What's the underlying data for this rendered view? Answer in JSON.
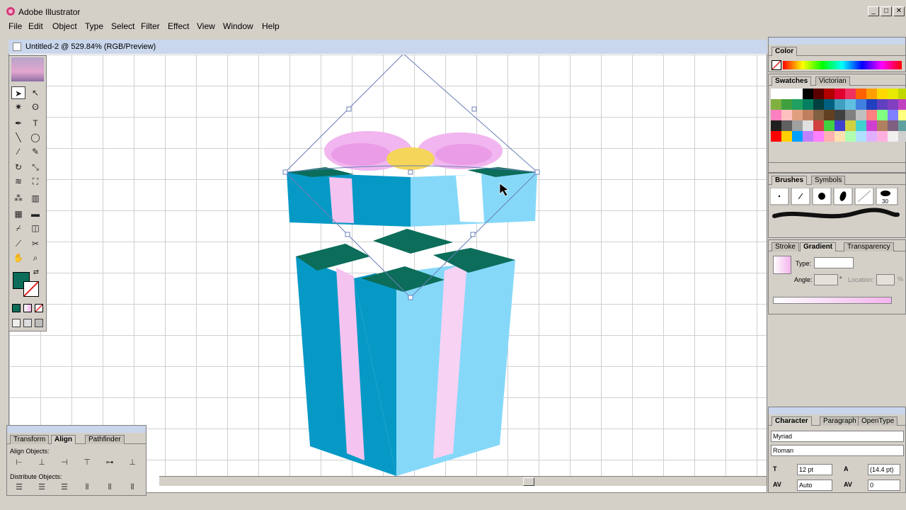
{
  "app": {
    "title": "Adobe Illustrator"
  },
  "window_buttons": {
    "minimize": "_",
    "maximize": "□",
    "close": "✕"
  },
  "menu": [
    "File",
    "Edit",
    "Object",
    "Type",
    "Select",
    "Filter",
    "Effect",
    "View",
    "Window",
    "Help"
  ],
  "document": {
    "title": "Untitled-2 @ 529.84% (RGB/Preview)"
  },
  "colors": {
    "teal": "#0b6d5a",
    "cyan_dark": "#0799c6",
    "cyan_light": "#86d8f9",
    "pink": "#f4c3ef",
    "pink_mid": "#ea9de6",
    "yellow": "#f5d55a",
    "selection": "#6a7fb8"
  },
  "color_panel": {
    "tab": "Color"
  },
  "swatches_panel": {
    "tabs": [
      "Swatches",
      "Victorian"
    ]
  },
  "brushes_panel": {
    "tabs": [
      "Brushes",
      "Symbols"
    ],
    "brush_size": "30"
  },
  "gradient_panel": {
    "tabs": [
      "Stroke",
      "Gradient",
      "Transparency"
    ],
    "type_label": "Type:",
    "angle_label": "Angle:",
    "angle_unit": "°",
    "location_label": "Location:",
    "location_unit": "%"
  },
  "character_panel": {
    "tabs": [
      "Character",
      "Paragraph",
      "OpenType"
    ],
    "font": "Myriad",
    "style": "Roman",
    "size": "12 pt",
    "leading": "(14.4 pt)",
    "kerning": "Auto",
    "tracking": "0"
  },
  "align_panel": {
    "tabs": [
      "Transform",
      "Align",
      "Pathfinder"
    ],
    "align_objects_label": "Align Objects:",
    "distribute_objects_label": "Distribute Objects:"
  },
  "icons": [
    "illustrator-app-icon",
    "selection-tool-icon",
    "direct-selection-tool-icon",
    "magic-wand-icon",
    "lasso-icon",
    "pen-icon",
    "type-icon",
    "line-icon",
    "ellipse-icon",
    "paintbrush-icon",
    "pencil-icon",
    "rotate-icon",
    "scale-icon",
    "warp-icon",
    "free-transform-icon",
    "symbol-sprayer-icon",
    "graph-icon",
    "mesh-icon",
    "gradient-icon",
    "eyedropper-icon",
    "blend-icon",
    "slice-icon",
    "scissors-icon",
    "hand-icon",
    "zoom-icon",
    "mouse-cursor-icon"
  ]
}
